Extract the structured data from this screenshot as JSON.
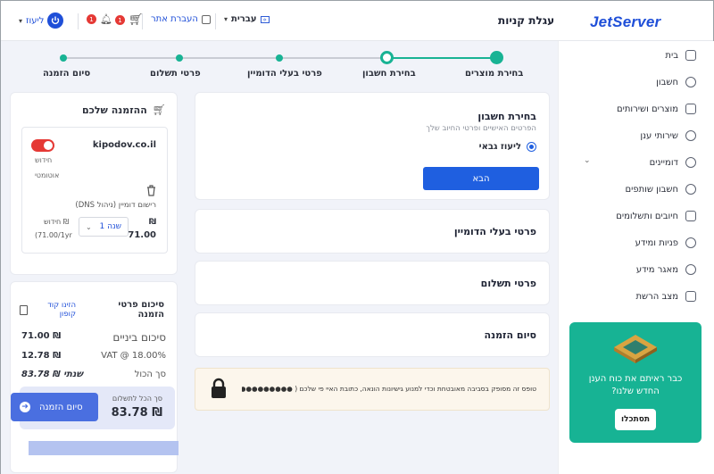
{
  "header": {
    "logo": "JetServer",
    "title": "עגלת קניות",
    "language": "עברית",
    "transfer": "העברת אתר",
    "cart_badge": "1",
    "notif_badge": "1",
    "user": "ליעוז"
  },
  "sidebar": {
    "items": [
      {
        "label": "בית",
        "icon": "home-icon"
      },
      {
        "label": "חשבון",
        "icon": "user-icon"
      },
      {
        "label": "מוצרים ושירותים",
        "icon": "box-icon"
      },
      {
        "label": "שירותי ענן",
        "icon": "cloud-icon"
      },
      {
        "label": "דומיינים",
        "icon": "globe-icon"
      },
      {
        "label": "חשבון שותפים",
        "icon": "users-icon"
      },
      {
        "label": "חיובים ותשלומים",
        "icon": "invoice-icon"
      },
      {
        "label": "פניות ומידע",
        "icon": "headset-icon"
      },
      {
        "label": "מאגר מידע",
        "icon": "bulb-icon"
      },
      {
        "label": "מצב הרשת",
        "icon": "chart-icon"
      }
    ],
    "banner_text": "כבר ראיתם את כוח הענן החדש שלנו?",
    "banner_button": "תסתכלו"
  },
  "steps": {
    "items": [
      "בחירת מוצרים",
      "בחירת חשבון",
      "פרטי בעלי הדומיין",
      "פרטי תשלום",
      "סיום הזמנה"
    ]
  },
  "account": {
    "title": "בחירת חשבון",
    "subtitle": "הפרטים האישיים ופרטי החיוב שלך",
    "option": "ליעוז גבאי",
    "next": "הבא"
  },
  "sections": {
    "owner": "פרטי בעלי הדומיין",
    "payment": "פרטי תשלום",
    "finish": "סיום הזמנה"
  },
  "notice": {
    "text": "טופס זה מסופק בסביבה מאובטחת וכדי למנוע גישיונות הונאה, כתובת האיי פי שלכם ( ●●●●●●●●●● ) מתועדת"
  },
  "order": {
    "title": "ההזמנה שלכם",
    "domain": "kipodov.co.il",
    "auto_renew_1": "חידוש",
    "auto_renew_2": "אוטומטי",
    "product": "רישום דומיין (ניהול DNS)",
    "price_symbol": "₪",
    "price": "71.00",
    "period": "1 שנה",
    "renew_label": "חידוש ₪",
    "renew_price": "(71.00/1yr"
  },
  "summary": {
    "title": "סיכום פרטי הזמנה",
    "coupon": "הזינו קוד קופון",
    "subtotal_label": "סיכום ביניים",
    "subtotal_value": "71.00 ₪",
    "vat_label": "VAT @ 18.00%",
    "vat_value": "12.78 ₪",
    "total_label": "סך הכול",
    "total_value": "83.78 ₪ שנתי",
    "pay_label": "סך הכל לתשלום",
    "pay_value": "83.78 ₪",
    "checkout": "סיום הזמנה"
  }
}
